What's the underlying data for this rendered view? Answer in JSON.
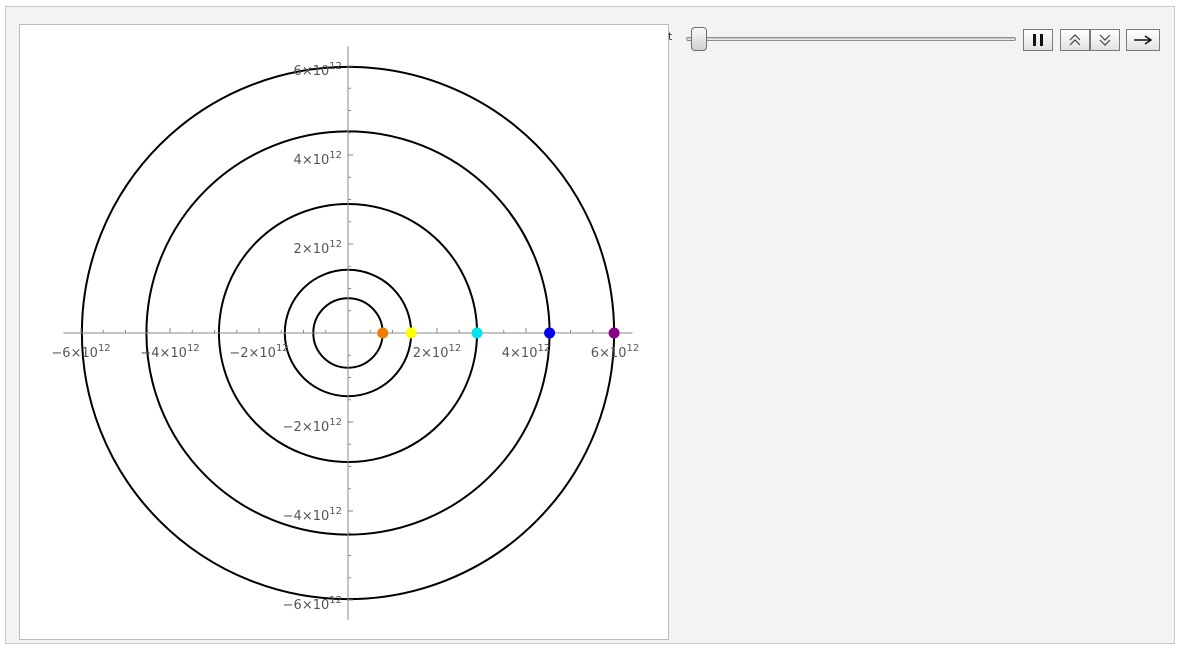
{
  "controls": {
    "slider_label": "t",
    "slider_value": 0.02,
    "icons": [
      "pause-icon",
      "faster-icon",
      "slower-icon",
      "direction-arrow-icon"
    ]
  },
  "chart_data": {
    "type": "scatter",
    "title": "",
    "xlabel": "",
    "ylabel": "",
    "xlim": [
      -6350000000000.0,
      6350000000000.0
    ],
    "ylim": [
      -6350000000000.0,
      6350000000000.0
    ],
    "grid": false,
    "axes": "centered at origin",
    "x_ticks": [
      {
        "value": -6000000000000.0,
        "mantissa": "−6×10",
        "exp": "12"
      },
      {
        "value": -4000000000000.0,
        "mantissa": "−4×10",
        "exp": "12"
      },
      {
        "value": -2000000000000.0,
        "mantissa": "−2×10",
        "exp": "12"
      },
      {
        "value": 2000000000000.0,
        "mantissa": "2×10",
        "exp": "12"
      },
      {
        "value": 4000000000000.0,
        "mantissa": "4×10",
        "exp": "12"
      },
      {
        "value": 6000000000000.0,
        "mantissa": "6×10",
        "exp": "12"
      }
    ],
    "y_ticks": [
      {
        "value": 6000000000000.0,
        "mantissa": "6×10",
        "exp": "12"
      },
      {
        "value": 4000000000000.0,
        "mantissa": "4×10",
        "exp": "12"
      },
      {
        "value": 2000000000000.0,
        "mantissa": "2×10",
        "exp": "12"
      },
      {
        "value": -2000000000000.0,
        "mantissa": "−2×10",
        "exp": "12"
      },
      {
        "value": -4000000000000.0,
        "mantissa": "−4×10",
        "exp": "12"
      },
      {
        "value": -6000000000000.0,
        "mantissa": "−6×10",
        "exp": "12"
      }
    ],
    "orbits": [
      {
        "radius": 780000000000.0,
        "color": "#000000"
      },
      {
        "radius": 1420000000000.0,
        "color": "#000000"
      },
      {
        "radius": 2900000000000.0,
        "color": "#000000"
      },
      {
        "radius": 4530000000000.0,
        "color": "#000000"
      },
      {
        "radius": 5980000000000.0,
        "color": "#000000"
      }
    ],
    "points": [
      {
        "x": 780000000000.0,
        "y": 0,
        "color": "#f07c00"
      },
      {
        "x": 1420000000000.0,
        "y": 0,
        "color": "#ffff00"
      },
      {
        "x": 2900000000000.0,
        "y": 0,
        "color": "#00e5ee"
      },
      {
        "x": 4530000000000.0,
        "y": 0,
        "color": "#0000ee"
      },
      {
        "x": 5980000000000.0,
        "y": 0,
        "color": "#8b008b"
      }
    ]
  }
}
